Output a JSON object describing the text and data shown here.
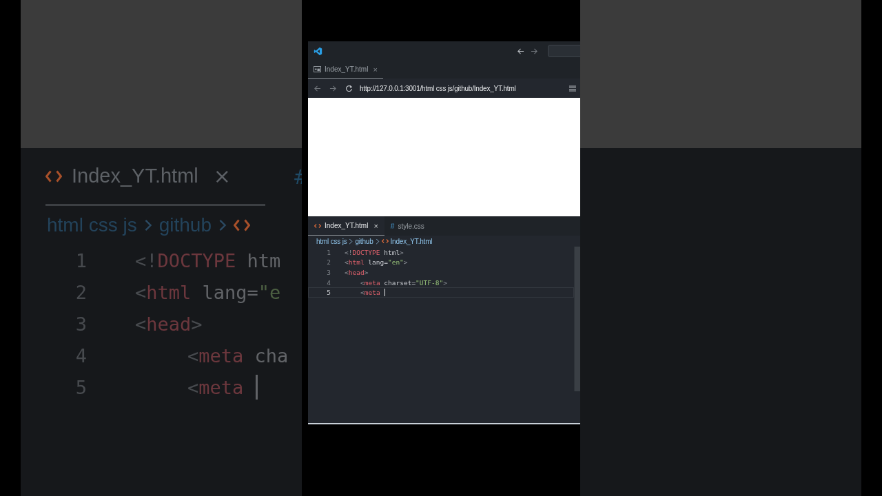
{
  "backdrop": {
    "tab": {
      "label": "Index_YT.html",
      "close": "×"
    },
    "next_tab_icon": "#",
    "breadcrumb": [
      "html css js",
      "github"
    ],
    "lines": [
      {
        "number": "1",
        "tokens": [
          {
            "kind": "punct",
            "text": "<!"
          },
          {
            "kind": "tag",
            "text": "DOCTYPE"
          },
          {
            "kind": "attr",
            "text": " htm"
          }
        ]
      },
      {
        "number": "2",
        "tokens": [
          {
            "kind": "punct",
            "text": "<"
          },
          {
            "kind": "tag",
            "text": "html"
          },
          {
            "kind": "attr",
            "text": " lang="
          },
          {
            "kind": "string",
            "text": "\"e"
          }
        ]
      },
      {
        "number": "3",
        "tokens": [
          {
            "kind": "punct",
            "text": "<"
          },
          {
            "kind": "tag",
            "text": "head"
          },
          {
            "kind": "punct",
            "text": ">"
          }
        ]
      },
      {
        "number": "4",
        "indent": true,
        "tokens": [
          {
            "kind": "punct",
            "text": "<"
          },
          {
            "kind": "tag",
            "text": "meta"
          },
          {
            "kind": "attr",
            "text": " cha"
          }
        ]
      },
      {
        "number": "5",
        "indent": true,
        "cursor": true,
        "tokens": [
          {
            "kind": "punct",
            "text": "<"
          },
          {
            "kind": "tag",
            "text": "meta"
          }
        ]
      }
    ]
  },
  "window": {
    "browser_tab": {
      "label": "Index_YT.html",
      "close": "×"
    },
    "address_bar": {
      "url": "http://127.0.0.1:3001/html css js/github/Index_YT.html"
    },
    "editor": {
      "tabs": [
        {
          "kind": "html",
          "label": "Index_YT.html",
          "close": "×",
          "selected": true
        },
        {
          "kind": "css",
          "icon": "#",
          "label": "style.css",
          "selected": false
        }
      ],
      "breadcrumb": [
        "html css js",
        "github",
        "Index_YT.html"
      ],
      "lines": [
        {
          "number": "1",
          "current": false,
          "tokens": [
            {
              "kind": "punct",
              "text": "<!"
            },
            {
              "kind": "tag",
              "text": "DOCTYPE"
            },
            {
              "kind": "attr",
              "text": " html"
            },
            {
              "kind": "punct",
              "text": ">"
            }
          ]
        },
        {
          "number": "2",
          "current": false,
          "tokens": [
            {
              "kind": "punct",
              "text": "<"
            },
            {
              "kind": "tag",
              "text": "html"
            },
            {
              "kind": "attr",
              "text": " lang="
            },
            {
              "kind": "string",
              "text": "\"en\""
            },
            {
              "kind": "punct",
              "text": ">"
            }
          ]
        },
        {
          "number": "3",
          "current": false,
          "tokens": [
            {
              "kind": "punct",
              "text": "<"
            },
            {
              "kind": "tag",
              "text": "head"
            },
            {
              "kind": "punct",
              "text": ">"
            }
          ]
        },
        {
          "number": "4",
          "current": false,
          "indent": true,
          "tokens": [
            {
              "kind": "punct",
              "text": "<"
            },
            {
              "kind": "tag",
              "text": "meta"
            },
            {
              "kind": "attr",
              "text": " charset="
            },
            {
              "kind": "string",
              "text": "\"UTF-8\""
            },
            {
              "kind": "punct",
              "text": ">"
            }
          ]
        },
        {
          "number": "5",
          "current": true,
          "indent": true,
          "cursor": true,
          "tokens": [
            {
              "kind": "punct",
              "text": "<"
            },
            {
              "kind": "tag",
              "text": "meta"
            }
          ]
        }
      ]
    }
  }
}
